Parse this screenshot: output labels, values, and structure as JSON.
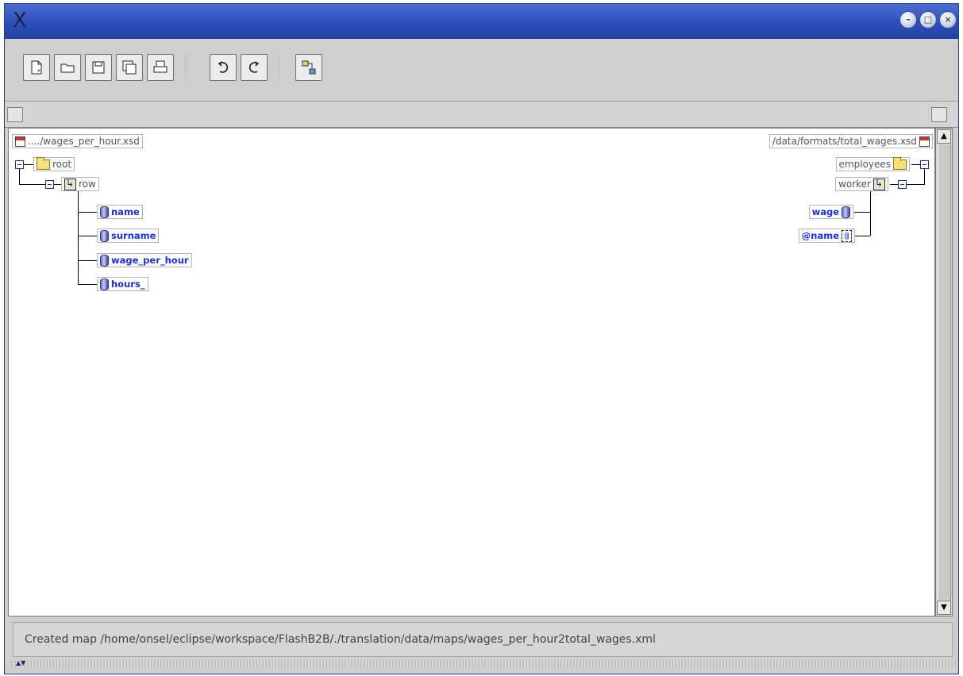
{
  "window": {
    "app_glyph": "X",
    "controls": [
      "minimize-icon",
      "maximize-icon",
      "close-icon"
    ]
  },
  "toolbar": {
    "buttons": [
      "new-icon",
      "open-icon",
      "save-icon",
      "save-as-icon",
      "print-icon",
      "undo-icon",
      "redo-icon",
      "map-icon"
    ]
  },
  "source": {
    "file": "..../wages_per_hour.xsd",
    "root": "root",
    "row": "row",
    "fields": [
      "name",
      "surname",
      "wage_per_hour",
      "hours_"
    ]
  },
  "target": {
    "file": "/data/formats/total_wages.xsd",
    "root": "employees",
    "row": "worker",
    "fields": [
      "wage",
      "@name"
    ]
  },
  "status": {
    "message": "Created map /home/onsel/eclipse/workspace/FlashB2B/./translation/data/maps/wages_per_hour2total_wages.xml"
  },
  "colors": {
    "titlebar": "#2d4fbf",
    "field_text": "#1d2fd6"
  }
}
